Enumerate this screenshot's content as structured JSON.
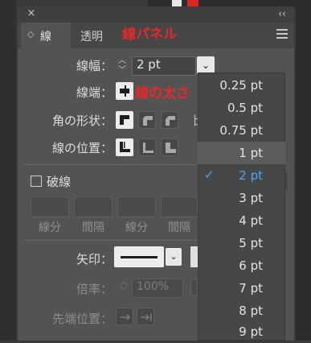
{
  "window": {
    "close_icon": "×",
    "collapse_icon": "‹‹",
    "tabs": [
      {
        "label": "線",
        "active": true
      },
      {
        "label": "透明",
        "active": false
      }
    ],
    "tab_active_prefix": "◇"
  },
  "annotations": {
    "panel_title": "線パネル",
    "stroke_width_note": "線の太さ"
  },
  "stroke": {
    "weight_label": "線幅：",
    "weight_value": "2 pt",
    "cap_label": "線端：",
    "corner_label": "角の形状：",
    "align_label": "線の位置：",
    "limit_label_fragment": "比"
  },
  "dashed": {
    "label": "破線",
    "checked": false,
    "columns": [
      "線分",
      "間隔",
      "線分",
      "間隔"
    ]
  },
  "arrows": {
    "label": "矢印："
  },
  "scale": {
    "label": "倍率：",
    "value": "100%"
  },
  "align_tip": {
    "label": "先端位置："
  },
  "weight_dropdown": {
    "options": [
      "0.25 pt",
      "0.5 pt",
      "0.75 pt",
      "1 pt",
      "2 pt",
      "3 pt",
      "4 pt",
      "5 pt",
      "6 pt",
      "7 pt",
      "8 pt",
      "9 pt"
    ],
    "highlighted": "1 pt",
    "selected": "2 pt"
  },
  "colors": {
    "annotation": "#e8292c",
    "selected_option": "#4aa3ff",
    "panel_bg": "#535353"
  }
}
